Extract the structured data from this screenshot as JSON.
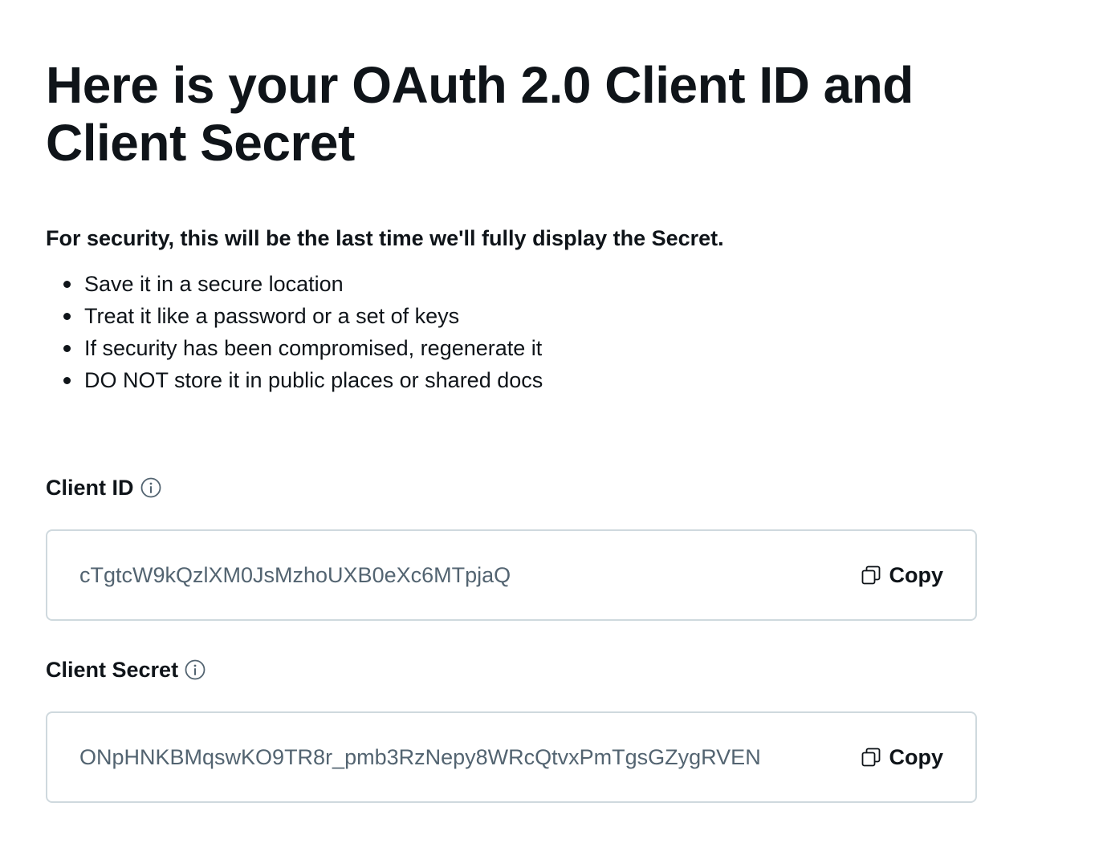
{
  "page": {
    "title": "Here is your OAuth 2.0 Client ID and Client Secret",
    "warning": "For security, this will be the last time we'll fully display the Secret.",
    "tips": [
      "Save it in a secure location",
      "Treat it like a password or a set of keys",
      "If security has been compromised, regenerate it",
      "DO NOT store it in public places or shared docs"
    ]
  },
  "client_id": {
    "label": "Client ID",
    "info_icon": "info-circle-icon",
    "value": "cTgtcW9kQzlXM0JsMzhoUXB0eXc6MTpjaQ",
    "copy_label": "Copy",
    "copy_icon": "copy-icon"
  },
  "client_secret": {
    "label": "Client Secret",
    "info_icon": "info-circle-icon",
    "value": "ONpHNKBMqswKO9TR8r_pmb3RzNepy8WRcQtvxPmTgsGZygRVEN",
    "copy_label": "Copy",
    "copy_icon": "copy-icon"
  },
  "colors": {
    "text": "#0f1419",
    "secondary_text": "#536471",
    "border": "#cfd9de",
    "background": "#ffffff"
  }
}
